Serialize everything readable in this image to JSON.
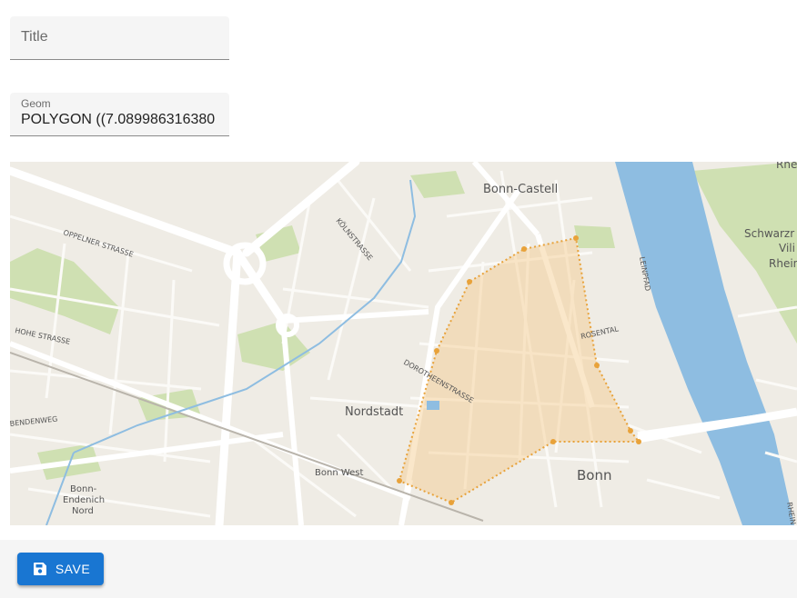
{
  "form": {
    "title_label": "Title",
    "title_value": "",
    "geom_label": "Geom",
    "geom_value": "POLYGON ((7.089986316380"
  },
  "map": {
    "labels": {
      "bonn_castell": "Bonn-Castell",
      "koelnstrasse": "KÖLNSTRASSE",
      "oppelner": "OPPELNER STRASSE",
      "hohe": "HOHE STRASSE",
      "leinpfad": "LEINPFAD",
      "rosental": "ROSENTAL",
      "dorotheen": "DOROTHEENSTRASSE",
      "nordstadt": "Nordstadt",
      "bonn": "Bonn",
      "bonn_west": "Bonn West",
      "endenich_1": "Bonn-",
      "endenich_2": "Endenich",
      "endenich_3": "Nord",
      "bendenweg": "BENDENWEG",
      "schwarz": "Schwarzr",
      "vili": "Vili",
      "rhein": "Rhein",
      "rhe": "Rhe",
      "rhein_vert": "RHEIN"
    },
    "colors": {
      "water": "#8ebde1",
      "land": "#efece5",
      "park": "#cfe0b2",
      "polygon_stroke": "#e8a23a",
      "polygon_fill": "#f3c98a"
    }
  },
  "actions": {
    "save_label": "SAVE",
    "save_icon": "floppy-disk-icon"
  }
}
